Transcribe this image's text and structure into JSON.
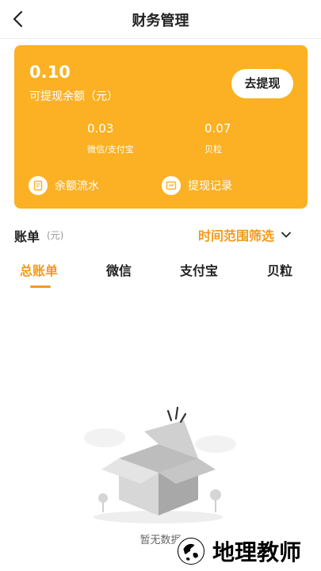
{
  "header": {
    "title": "财务管理",
    "back_icon": "back-chevron-icon"
  },
  "balance_card": {
    "amount": "0.10",
    "amount_label": "可提现余额（元）",
    "withdraw_button": "去提现",
    "wechat_alipay_value": "0.03",
    "wechat_alipay_label": "微信/支付宝",
    "beili_value": "0.07",
    "beili_label": "贝粒",
    "links": [
      {
        "label": "余额流水",
        "icon": "balance-flow-icon"
      },
      {
        "label": "提现记录",
        "icon": "withdraw-record-icon"
      }
    ],
    "accent": "#fbb123"
  },
  "bill": {
    "title": "账单",
    "unit": "(元)",
    "filter_label": "时间范围筛选",
    "accent": "#f39a1b"
  },
  "tabs": [
    {
      "label": "总账单",
      "active": true
    },
    {
      "label": "微信",
      "active": false
    },
    {
      "label": "支付宝",
      "active": false
    },
    {
      "label": "贝粒",
      "active": false
    }
  ],
  "empty_state": {
    "text": "暂无数据",
    "icon": "empty-box-icon"
  },
  "watermark": {
    "text": "地理教师"
  }
}
